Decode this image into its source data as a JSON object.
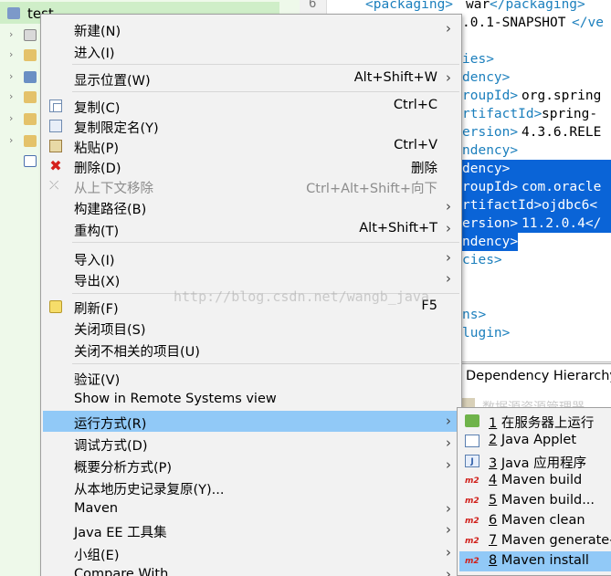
{
  "explorer": {
    "project_name": "test"
  },
  "editor": {
    "line_number": "6",
    "lines": [
      {
        "tag1": "<packaging>",
        "text": "war",
        "tag2": "</packaging>"
      },
      {
        "tag1": "",
        "text": ".0.1-SNAPSHOT",
        "tag2": "</ve"
      },
      {
        "tag1": "ies>",
        "text": "",
        "tag2": ""
      },
      {
        "tag1": "dency>",
        "text": "",
        "tag2": ""
      },
      {
        "tag1": "roupId>",
        "text": "org.spring",
        "tag2": ""
      },
      {
        "tag1": "rtifactId>",
        "text": "spring-",
        "tag2": ""
      },
      {
        "tag1": "ersion>",
        "text": "4.3.6.RELE",
        "tag2": ""
      },
      {
        "tag1": "ndency>",
        "text": "",
        "tag2": ""
      },
      {
        "tag1": "dency>",
        "text": "",
        "tag2": ""
      },
      {
        "tag1": "roupId>",
        "text": "com.oracle",
        "tag2": ""
      },
      {
        "tag1": "rtifactId>",
        "text": "ojdbc6<",
        "tag2": ""
      },
      {
        "tag1": "ersion>",
        "text": "11.2.0.4</",
        "tag2": ""
      },
      {
        "tag1": "ndency>",
        "text": "",
        "tag2": ""
      },
      {
        "tag1": "cies>",
        "text": "",
        "tag2": ""
      },
      {
        "tag1": "",
        "text": "",
        "tag2": ""
      },
      {
        "tag1": "",
        "text": "",
        "tag2": ""
      },
      {
        "tag1": "ns>",
        "text": "",
        "tag2": ""
      },
      {
        "tag1": "lugin>",
        "text": "",
        "tag2": ""
      }
    ]
  },
  "dependency_tab": {
    "label": "Dependency Hierarchy",
    "faded_text": "数据源资源管理器"
  },
  "watermark": "http://blog.csdn.net/wangb_java",
  "context_menu": {
    "items": [
      {
        "label": "新建(N)",
        "shortcut": "",
        "submenu": true
      },
      {
        "label": "进入(I)",
        "shortcut": "",
        "submenu": false
      },
      {
        "label": "显示位置(W)",
        "shortcut": "Alt+Shift+W",
        "submenu": true
      },
      {
        "label": "复制(C)",
        "shortcut": "Ctrl+C",
        "submenu": false,
        "icon": "copy-icon"
      },
      {
        "label": "复制限定名(Y)",
        "shortcut": "",
        "submenu": false,
        "icon": "copy-qualified-icon"
      },
      {
        "label": "粘贴(P)",
        "shortcut": "Ctrl+V",
        "submenu": false,
        "icon": "paste-icon"
      },
      {
        "label": "删除(D)",
        "shortcut": "删除",
        "submenu": false,
        "icon": "delete-icon"
      },
      {
        "label": "从上下文移除",
        "shortcut": "Ctrl+Alt+Shift+向下",
        "submenu": false,
        "icon": "remove-context-icon",
        "disabled": true
      },
      {
        "label": "构建路径(B)",
        "shortcut": "",
        "submenu": true
      },
      {
        "label": "重构(T)",
        "shortcut": "Alt+Shift+T",
        "submenu": true
      },
      {
        "label": "导入(I)",
        "shortcut": "",
        "submenu": true
      },
      {
        "label": "导出(X)",
        "shortcut": "",
        "submenu": true
      },
      {
        "label": "刷新(F)",
        "shortcut": "F5",
        "submenu": false,
        "icon": "refresh-icon"
      },
      {
        "label": "关闭项目(S)",
        "shortcut": "",
        "submenu": false
      },
      {
        "label": "关闭不相关的项目(U)",
        "shortcut": "",
        "submenu": false
      },
      {
        "label": "验证(V)",
        "shortcut": "",
        "submenu": false
      },
      {
        "label": "Show in Remote Systems view",
        "shortcut": "",
        "submenu": false
      },
      {
        "label": "运行方式(R)",
        "shortcut": "",
        "submenu": true,
        "active": true
      },
      {
        "label": "调试方式(D)",
        "shortcut": "",
        "submenu": true
      },
      {
        "label": "概要分析方式(P)",
        "shortcut": "",
        "submenu": true
      },
      {
        "label": "从本地历史记录复原(Y)...",
        "shortcut": "",
        "submenu": false
      },
      {
        "label": "Maven",
        "shortcut": "",
        "submenu": true
      },
      {
        "label": "Java EE 工具集",
        "shortcut": "",
        "submenu": true
      },
      {
        "label": "小组(E)",
        "shortcut": "",
        "submenu": true
      },
      {
        "label": "Compare With",
        "shortcut": "",
        "submenu": true
      }
    ]
  },
  "run_as_submenu": {
    "items": [
      {
        "num": "1",
        "label": " 在服务器上运行",
        "icon": "server-icon"
      },
      {
        "num": "2",
        "label": " Java Applet",
        "icon": "applet-icon"
      },
      {
        "num": "3",
        "label": " Java 应用程序",
        "icon": "java-app-icon"
      },
      {
        "num": "4",
        "label": " Maven build",
        "icon": "maven-icon"
      },
      {
        "num": "5",
        "label": " Maven build...",
        "icon": "maven-icon"
      },
      {
        "num": "6",
        "label": " Maven clean",
        "icon": "maven-icon"
      },
      {
        "num": "7",
        "label": " Maven generate-",
        "icon": "maven-icon"
      },
      {
        "num": "8",
        "label": " Maven install",
        "icon": "maven-icon",
        "active": true
      }
    ],
    "maven_icon_text": "m2",
    "java_icon_text": "J"
  },
  "colors": {
    "selection": "#91c9f7",
    "editor_highlight": "#0a64d7",
    "xml_tag": "#1b7fbd"
  }
}
